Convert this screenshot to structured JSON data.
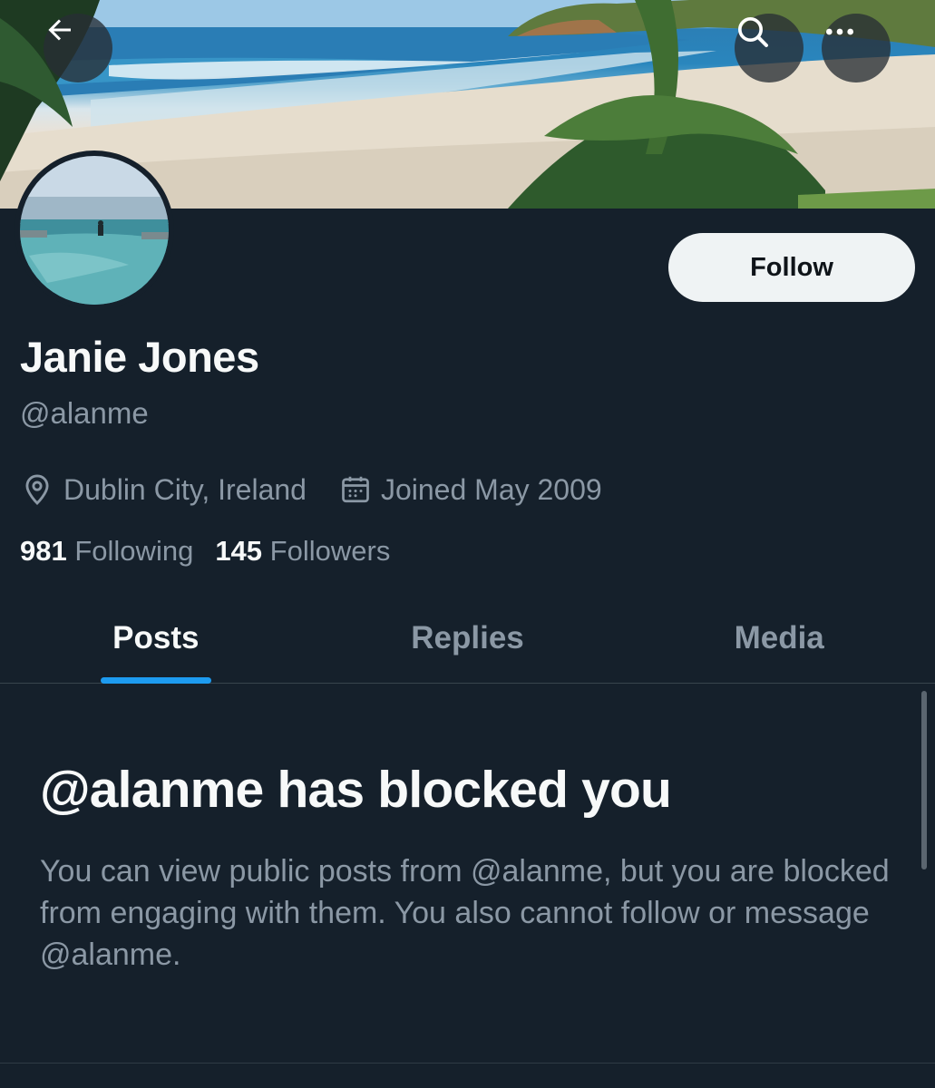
{
  "header": {
    "back_icon": "arrow-left-icon",
    "search_icon": "search-icon",
    "more_icon": "more-horizontal-icon"
  },
  "profile": {
    "display_name": "Janie Jones",
    "handle": "@alanme",
    "location": "Dublin City, Ireland",
    "joined": "Joined May 2009",
    "following_count": "981",
    "following_label": "Following",
    "followers_count": "145",
    "followers_label": "Followers",
    "follow_label": "Follow"
  },
  "tabs": [
    {
      "label": "Posts",
      "active": true
    },
    {
      "label": "Replies",
      "active": false
    },
    {
      "label": "Media",
      "active": false
    }
  ],
  "blocked": {
    "title": "@alanme has blocked you",
    "body": "You can view public posts from @alanme, but you are blocked from engaging with them. You also cannot follow or message @alanme."
  },
  "colors": {
    "background": "#15202b",
    "accent": "#1d9bf0",
    "secondary_text": "#8b98a5",
    "follow_button_bg": "#eff3f4"
  }
}
